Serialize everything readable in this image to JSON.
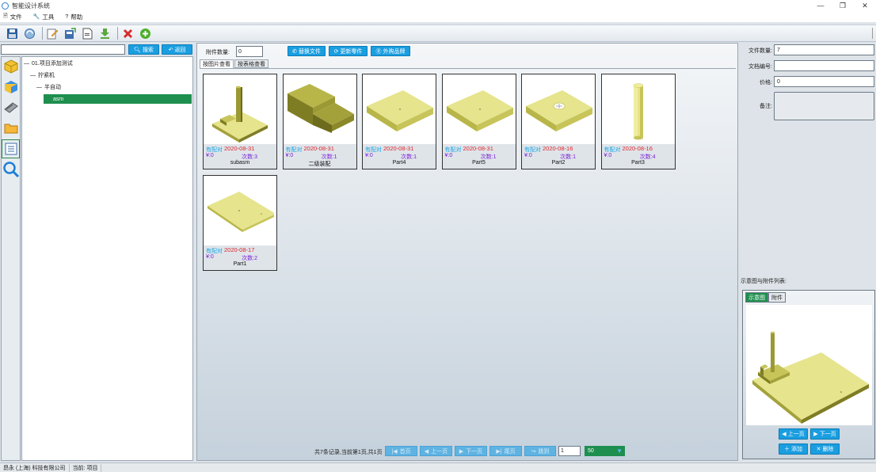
{
  "window": {
    "title": "智能设计系统",
    "controls": [
      "—",
      "❐",
      "✕"
    ]
  },
  "menu": [
    {
      "label": "文件",
      "icon": "document-icon"
    },
    {
      "label": "工具",
      "icon": "wrench-icon"
    },
    {
      "label": "帮助",
      "icon": "help-icon"
    }
  ],
  "toolbar": {
    "items": [
      "save-icon",
      "refresh-icon",
      "edit-icon",
      "export-icon",
      "new-file-icon",
      "download-icon",
      "delete-icon",
      "add-icon"
    ]
  },
  "left": {
    "search_value": "",
    "search_label": "搜索",
    "back_label": "返回",
    "tree": [
      {
        "label": "01.项目添加测试",
        "level": 0
      },
      {
        "label": "拧紧机",
        "level": 1
      },
      {
        "label": "半自动",
        "level": 2
      },
      {
        "label": "asm",
        "level": 3,
        "selected": true
      }
    ]
  },
  "mid": {
    "count_label": "附件数量:",
    "count_value": "0",
    "actions": [
      "替换文件",
      "更新零件",
      "外购品牌"
    ],
    "tabs": [
      "按图片查看",
      "按表格查看"
    ],
    "cards": [
      {
        "status": "有配对",
        "date": "2020-08-31",
        "price": "¥:0",
        "times": "次数:3",
        "name": "subasm",
        "shape": "subasm"
      },
      {
        "status": "有配对",
        "date": "2020-08-31",
        "price": "¥:0",
        "times": "次数:1",
        "name": "二级装配",
        "shape": "step"
      },
      {
        "status": "有配对",
        "date": "2020-08-31",
        "price": "¥:0",
        "times": "次数:1",
        "name": "Part4",
        "shape": "plate"
      },
      {
        "status": "有配对",
        "date": "2020-08-31",
        "price": "¥:0",
        "times": "次数:1",
        "name": "Part5",
        "shape": "plate"
      },
      {
        "status": "有配对",
        "date": "2020-08-16",
        "price": "¥:0",
        "times": "次数:1",
        "name": "Part2",
        "shape": "plate-hole"
      },
      {
        "status": "有配对",
        "date": "2020-08-16",
        "price": "¥:0",
        "times": "次数:4",
        "name": "Part3",
        "shape": "cylinder"
      },
      {
        "status": "有配对",
        "date": "2020-08-17",
        "price": "¥:0",
        "times": "次数:2",
        "name": "Part1",
        "shape": "thin-plate"
      }
    ],
    "pager": {
      "info": "共7条记录,当前第1页,共1页",
      "first": "首页",
      "prev": "上一页",
      "next": "下一页",
      "last": "尾页",
      "goto": "跳到",
      "page_input": "1",
      "page_size": "50"
    }
  },
  "right": {
    "file_count_label": "文件数量:",
    "file_count_value": "7",
    "file_no_label": "文档编号:",
    "file_no_value": "",
    "price_label": "价格:",
    "price_value": "0",
    "note_label": "备注:",
    "preview_title": "示意图与附件列表:",
    "preview_tabs": [
      "示意图",
      "附件"
    ],
    "prev_label": "上一页",
    "next_label": "下一页",
    "add_label": "添加",
    "delete_label": "删除"
  },
  "status": {
    "company": "昂永 (上海) 科技有限公司",
    "current": "当前: 项目"
  },
  "colors": {
    "accent_blue": "#1a9ee0",
    "selected_green": "#1e8f4e",
    "part_olive": "#a3a13a",
    "part_light": "#e6e48c"
  }
}
